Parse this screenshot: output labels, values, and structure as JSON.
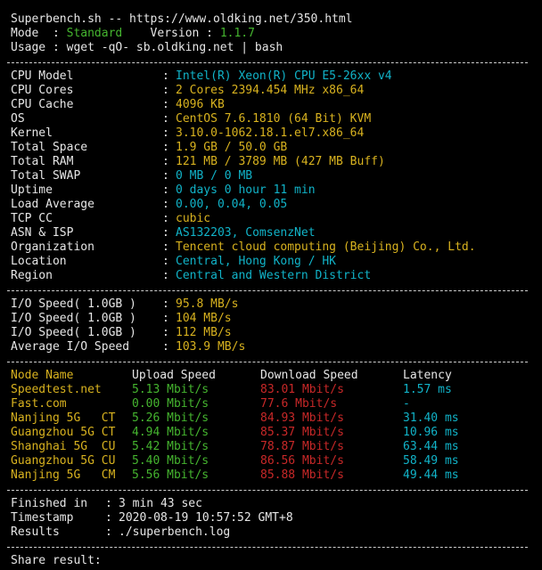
{
  "colors": {
    "background": "#000000",
    "text": "#e6e6e6",
    "cyan": "#11b3c8",
    "yellow": "#d8b21f",
    "green": "#45b52f",
    "red": "#c82828"
  },
  "header": {
    "title_line": "Superbench.sh -- https://www.oldking.net/350.html",
    "mode_label": "Mode  : ",
    "mode_value": "Standard",
    "version_label": "    Version : ",
    "version_value": "1.1.7",
    "usage_line": "Usage : wget -qO- sb.oldking.net | bash"
  },
  "system": {
    "rows": [
      {
        "label": "CPU Model",
        "value": "Intel(R) Xeon(R) CPU E5-26xx v4",
        "color": "cyan"
      },
      {
        "label": "CPU Cores",
        "value": "2 Cores 2394.454 MHz x86_64",
        "color": "yellow"
      },
      {
        "label": "CPU Cache",
        "value": "4096 KB",
        "color": "yellow"
      },
      {
        "label": "OS",
        "value": "CentOS 7.6.1810 (64 Bit) KVM",
        "color": "yellow"
      },
      {
        "label": "Kernel",
        "value": "3.10.0-1062.18.1.el7.x86_64",
        "color": "yellow"
      },
      {
        "label": "Total Space",
        "value": "1.9 GB / 50.0 GB",
        "color": "yellow"
      },
      {
        "label": "Total RAM",
        "value": "121 MB / 3789 MB (427 MB Buff)",
        "color": "yellow"
      },
      {
        "label": "Total SWAP",
        "value": "0 MB / 0 MB",
        "color": "cyan"
      },
      {
        "label": "Uptime",
        "value": "0 days 0 hour 11 min",
        "color": "cyan"
      },
      {
        "label": "Load Average",
        "value": "0.00, 0.04, 0.05",
        "color": "cyan"
      },
      {
        "label": "TCP CC",
        "value": "cubic",
        "color": "yellow"
      },
      {
        "label": "ASN & ISP",
        "value": "AS132203, ComsenzNet",
        "color": "cyan"
      },
      {
        "label": "Organization",
        "value": "Tencent cloud computing (Beijing) Co., Ltd.",
        "color": "yellow"
      },
      {
        "label": "Location",
        "value": "Central, Hong Kong / HK",
        "color": "cyan"
      },
      {
        "label": "Region",
        "value": "Central and Western District",
        "color": "cyan"
      }
    ]
  },
  "io": {
    "rows": [
      {
        "label": "I/O Speed( 1.0GB )",
        "value": "95.8 MB/s"
      },
      {
        "label": "I/O Speed( 1.0GB )",
        "value": "104 MB/s"
      },
      {
        "label": "I/O Speed( 1.0GB )",
        "value": "112 MB/s"
      },
      {
        "label": "Average I/O Speed",
        "value": "103.9 MB/s"
      }
    ]
  },
  "speedtest": {
    "headers": [
      "Node Name",
      "Upload Speed",
      "Download Speed",
      "Latency"
    ],
    "rows": [
      {
        "node": "Speedtest.net",
        "upload": "5.13 Mbit/s",
        "download": "83.01 Mbit/s",
        "latency": "1.57 ms"
      },
      {
        "node": "Fast.com",
        "upload": "0.00 Mbit/s",
        "download": "77.6 Mbit/s",
        "latency": "-"
      },
      {
        "node": "Nanjing 5G   CT",
        "upload": "5.26 Mbit/s",
        "download": "84.93 Mbit/s",
        "latency": "31.40 ms"
      },
      {
        "node": "Guangzhou 5G CT",
        "upload": "4.94 Mbit/s",
        "download": "85.37 Mbit/s",
        "latency": "10.96 ms"
      },
      {
        "node": "Shanghai 5G  CU",
        "upload": "5.42 Mbit/s",
        "download": "78.87 Mbit/s",
        "latency": "63.44 ms"
      },
      {
        "node": "Guangzhou 5G CU",
        "upload": "5.40 Mbit/s",
        "download": "86.56 Mbit/s",
        "latency": "58.49 ms"
      },
      {
        "node": "Nanjing 5G   CM",
        "upload": "5.56 Mbit/s",
        "download": "85.88 Mbit/s",
        "latency": "49.44 ms"
      }
    ]
  },
  "summary": {
    "rows": [
      {
        "label": "Finished in ",
        "value": "3 min 43 sec"
      },
      {
        "label": "Timestamp   ",
        "value": "2020-08-19 10:57:52 GMT+8"
      },
      {
        "label": "Results     ",
        "value": "./superbench.log"
      }
    ],
    "share_line": "Share result:"
  }
}
